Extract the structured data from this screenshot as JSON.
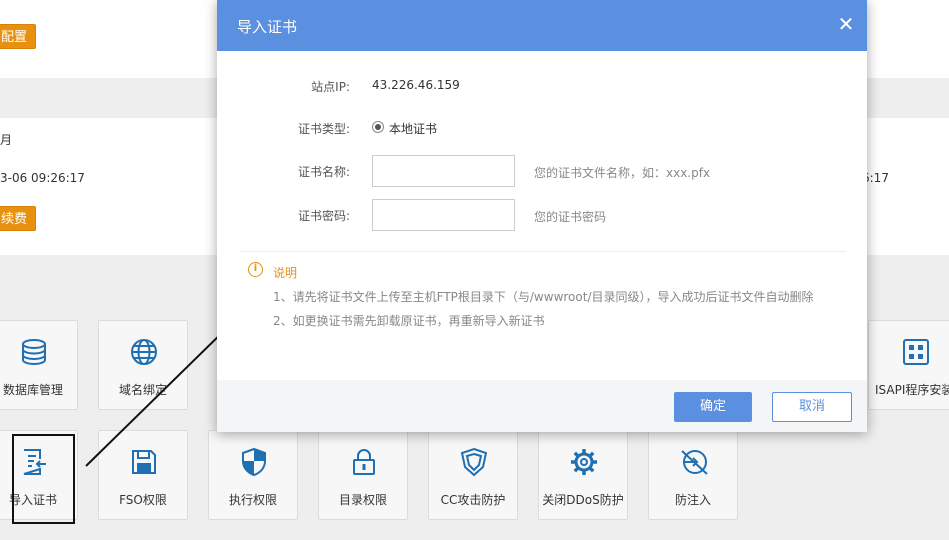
{
  "background": {
    "caret": "^",
    "config_button": "配置",
    "row_label": "月",
    "datetime_left": "3-06 09:26:17",
    "datetime_right": "6:17",
    "renew_button": "续费",
    "tools": [
      {
        "label": "数据库管理",
        "icon": "database-icon"
      },
      {
        "label": "域名绑定",
        "icon": "globe-icon"
      },
      {
        "label": "ISAPI程序安装",
        "icon": "apps-grid-icon"
      },
      {
        "label": "导入证书",
        "icon": "certificate-import-icon"
      },
      {
        "label": "FSO权限",
        "icon": "floppy-disk-icon"
      },
      {
        "label": "执行权限",
        "icon": "shield-icon"
      },
      {
        "label": "目录权限",
        "icon": "lock-icon"
      },
      {
        "label": "CC攻击防护",
        "icon": "shield-outline-icon"
      },
      {
        "label": "关闭DDoS防护",
        "icon": "gear-icon"
      },
      {
        "label": "防注入",
        "icon": "no-injection-icon"
      }
    ]
  },
  "modal": {
    "title": "导入证书",
    "close_symbol": "✕",
    "fields": {
      "site_ip_label": "站点IP:",
      "site_ip_value": "43.226.46.159",
      "cert_type_label": "证书类型:",
      "cert_type_option": "本地证书",
      "cert_name_label": "证书名称:",
      "cert_name_value": "",
      "cert_name_hint": "您的证书文件名称，如：xxx.pfx",
      "cert_password_label": "证书密码:",
      "cert_password_value": "",
      "cert_password_hint": "您的证书密码"
    },
    "note": {
      "icon_symbol": "i",
      "title": "说明",
      "lines": [
        "1、请先将证书文件上传至主机FTP根目录下（与/wwwroot/目录同级），导入成功后证书文件自动删除",
        "2、如更换证书需先卸载原证书，再重新导入新证书"
      ]
    },
    "buttons": {
      "ok": "确定",
      "cancel": "取消"
    }
  },
  "colors": {
    "accent": "#5b8fe0",
    "orange": "#e8900f"
  }
}
